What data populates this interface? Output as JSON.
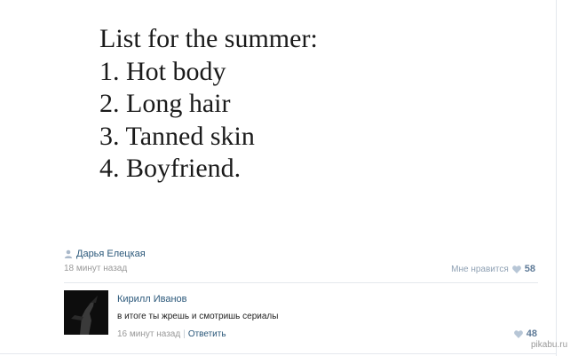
{
  "post": {
    "image_lines": [
      "List for the summer:",
      "1. Hot body",
      "2. Long hair",
      "3. Tanned skin",
      "4. Boyfriend."
    ],
    "author": "Дарья Елецкая",
    "time": "18 минут назад",
    "like_label": "Мне нравится",
    "like_count": "58"
  },
  "comment": {
    "author": "Кирилл Иванов",
    "text": "в итоге ты жрешь и смотришь сериалы",
    "time": "16 минут назад",
    "separator": "|",
    "reply_label": "Ответить",
    "like_count": "48"
  },
  "watermark": "pikabu.ru",
  "colors": {
    "link": "#2b587a",
    "muted": "#999999",
    "like": "#5f7b98",
    "heart": "#b7c6d6"
  },
  "icons": {
    "author": "person-icon",
    "like": "heart-icon"
  }
}
